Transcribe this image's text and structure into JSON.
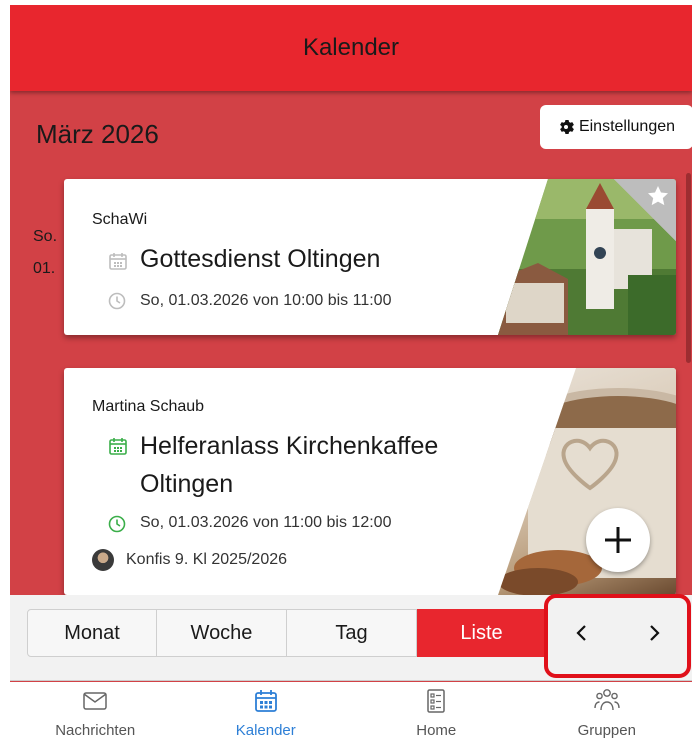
{
  "header": {
    "title": "Kalender"
  },
  "calendar": {
    "month_label": "März 2026",
    "settings_label": "Einstellungen"
  },
  "day": {
    "weekday": "So.",
    "date": "01."
  },
  "events": [
    {
      "author": "SchaWi",
      "title": "Gottesdienst Oltingen",
      "time": "So, 01.03.2026 von 10:00 bis 11:00",
      "calendar_icon": "calendar-icon-gray",
      "favorite_icon": "star-icon"
    },
    {
      "author": "Martina Schaub",
      "title_line1": "Helferanlass Kirchenkaffee",
      "title_line2": "Oltingen",
      "time": "So, 01.03.2026 von 11:00 bis 12:00",
      "group": "Konfis 9. Kl 2025/2026",
      "calendar_icon": "calendar-icon-green"
    }
  ],
  "view_modes": [
    "Monat",
    "Woche",
    "Tag",
    "Liste"
  ],
  "active_view": "Liste",
  "nav": {
    "prev": "‹",
    "next": "›"
  },
  "tabs": [
    {
      "label": "Nachrichten",
      "icon": "mail-icon"
    },
    {
      "label": "Kalender",
      "icon": "calendar-icon"
    },
    {
      "label": "Home",
      "icon": "home-icon"
    },
    {
      "label": "Gruppen",
      "icon": "groups-icon"
    }
  ],
  "colors": {
    "brand_red": "#e8262e",
    "page_red": "#d24146",
    "active_tab": "#2d7fd6",
    "green": "#3aae49"
  }
}
